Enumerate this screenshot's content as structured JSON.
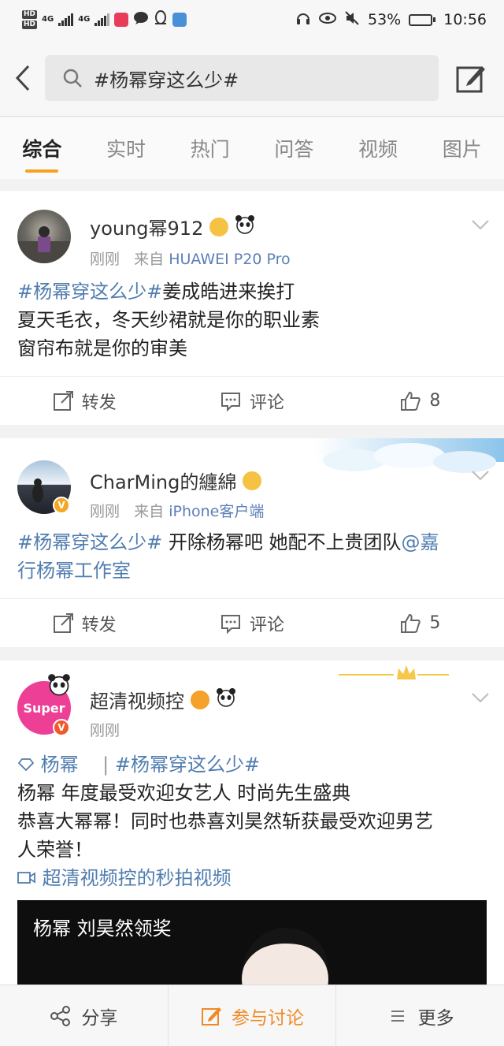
{
  "status_bar": {
    "hd1": "HD",
    "hd2": "HD",
    "net1": "4G",
    "net2": "4G",
    "battery_percent": "53%",
    "battery_level": 0.53,
    "time": "10:56"
  },
  "search": {
    "query": "#杨幂穿这么少#"
  },
  "tabs": [
    "综合",
    "实时",
    "热门",
    "问答",
    "视频",
    "图片"
  ],
  "active_tab": "综合",
  "posts": [
    {
      "username": "young幂912",
      "time": "刚刚",
      "source_prefix": "来自",
      "device": "HUAWEI P20 Pro",
      "tag": "#杨幂穿这么少#",
      "lines": [
        "姜成皓进来挨打",
        "夏天毛衣，冬天纱裙就是你的职业素",
        "窗帘布就是你的审美"
      ],
      "repost_label": "转发",
      "comment_label": "评论",
      "likes": "8"
    },
    {
      "username": "CharMing的纏綿",
      "time": "刚刚",
      "source_prefix": "来自",
      "device": "iPhone客户端",
      "tag": "#杨幂穿这么少#",
      "text_a": " 开除杨幂吧 她配不上贵团队",
      "mention_a": "@嘉",
      "mention_b": "行杨幂工作室",
      "repost_label": "转发",
      "comment_label": "评论",
      "likes": "5"
    },
    {
      "username": "超清视频控",
      "avatar_text": "Super",
      "time": "刚刚",
      "super_topic": "杨幂",
      "separator": "|",
      "tag": "#杨幂穿这么少#",
      "lines": [
        "杨幂 年度最受欢迎女艺人 时尚先生盛典",
        "恭喜大幂幂！同时也恭喜刘昊然斩获最受欢迎男艺",
        "人荣誉！"
      ],
      "video_link": "超清视频控的秒拍视频",
      "video_title": "杨幂 刘昊然领奖"
    }
  ],
  "bottom_bar": {
    "share": "分享",
    "discuss": "参与讨论",
    "more": "更多"
  },
  "colors": {
    "accent": "#f8a021",
    "link": "#507daf",
    "discuss": "#f08a24"
  }
}
